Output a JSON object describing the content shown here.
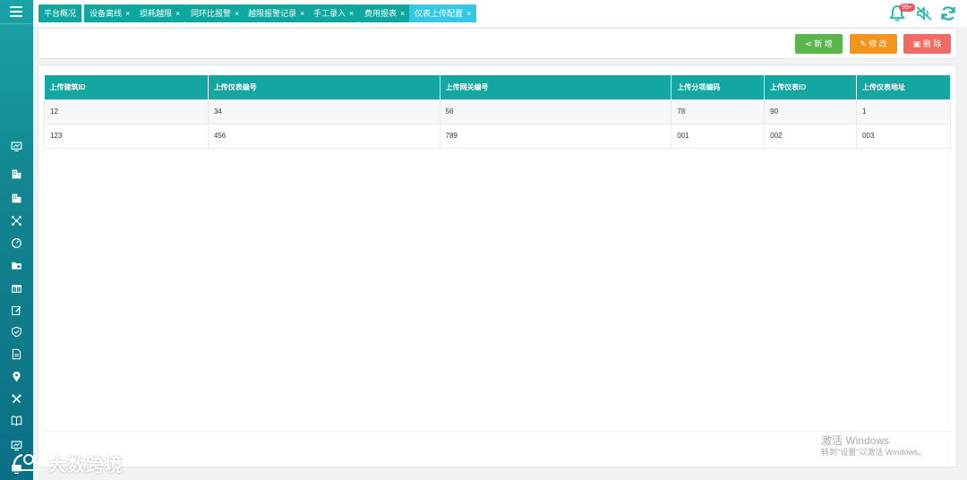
{
  "tabs": [
    {
      "label": "平台概况",
      "close": ""
    },
    {
      "label": "设备离线",
      "close": "×"
    },
    {
      "label": "损耗越限",
      "close": "×"
    },
    {
      "label": "同环比报警",
      "close": "×"
    },
    {
      "label": "越限报警记录",
      "close": "×"
    },
    {
      "label": "手工录入",
      "close": "×"
    },
    {
      "label": "费用报表",
      "close": "×"
    },
    {
      "label": "仪表上传配置",
      "close": "×"
    }
  ],
  "notifications": {
    "badge": "99+"
  },
  "toolbar": {
    "add_label": "新 增",
    "edit_label": "修 改",
    "delete_label": "删 除"
  },
  "table": {
    "headers": [
      "上传建筑ID",
      "上传仪表编号",
      "上传网关编号",
      "上传分项编码",
      "上传仪表ID",
      "上传仪表地址"
    ],
    "rows": [
      [
        "12",
        "34",
        "56",
        "78",
        "90",
        "1"
      ],
      [
        "123",
        "456",
        "789",
        "001",
        "002",
        "003"
      ]
    ]
  },
  "watermark": {
    "title": "激活 Windows",
    "subtitle": "转到\"设置\"以激活 Windows。",
    "logo_text": "大数跨境"
  },
  "colors": {
    "accent": "#14a6a0",
    "active_tab": "#35c8e6",
    "add": "#5ab64a",
    "edit": "#f2941d",
    "delete": "#ef6b63"
  }
}
